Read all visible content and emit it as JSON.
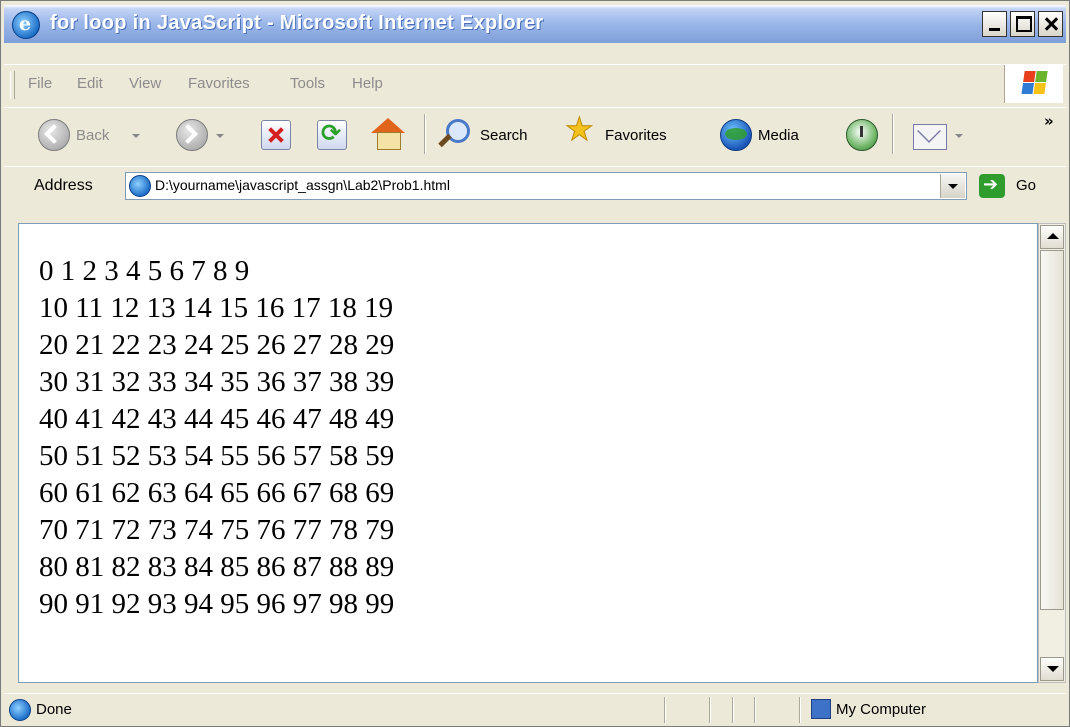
{
  "window": {
    "title": "for loop in JavaScript - Microsoft Internet Explorer"
  },
  "menu": [
    "File",
    "Edit",
    "View",
    "Favorites",
    "Tools",
    "Help"
  ],
  "toolbar": {
    "back_label": "Back",
    "search_label": "Search",
    "favorites_label": "Favorites",
    "media_label": "Media"
  },
  "address": {
    "label": "Address",
    "url": "D:\\yourname\\javascript_assgn\\Lab2\\Prob1.html",
    "go_label": "Go"
  },
  "content": {
    "lines": [
      "0 1 2 3 4 5 6 7 8 9",
      "10 11 12 13 14 15 16 17 18 19",
      "20 21 22 23 24 25 26 27 28 29",
      "30 31 32 33 34 35 36 37 38 39",
      "40 41 42 43 44 45 46 47 48 49",
      "50 51 52 53 54 55 56 57 58 59",
      "60 61 62 63 64 65 66 67 68 69",
      "70 71 72 73 74 75 76 77 78 79",
      "80 81 82 83 84 85 86 87 88 89",
      "90 91 92 93 94 95 96 97 98 99"
    ]
  },
  "status": {
    "text": "Done",
    "zone": "My Computer"
  },
  "colors": {
    "title_bar": "#7f9fd9",
    "chrome": "#ece9d8",
    "disabled_text": "#8c8c8c"
  }
}
